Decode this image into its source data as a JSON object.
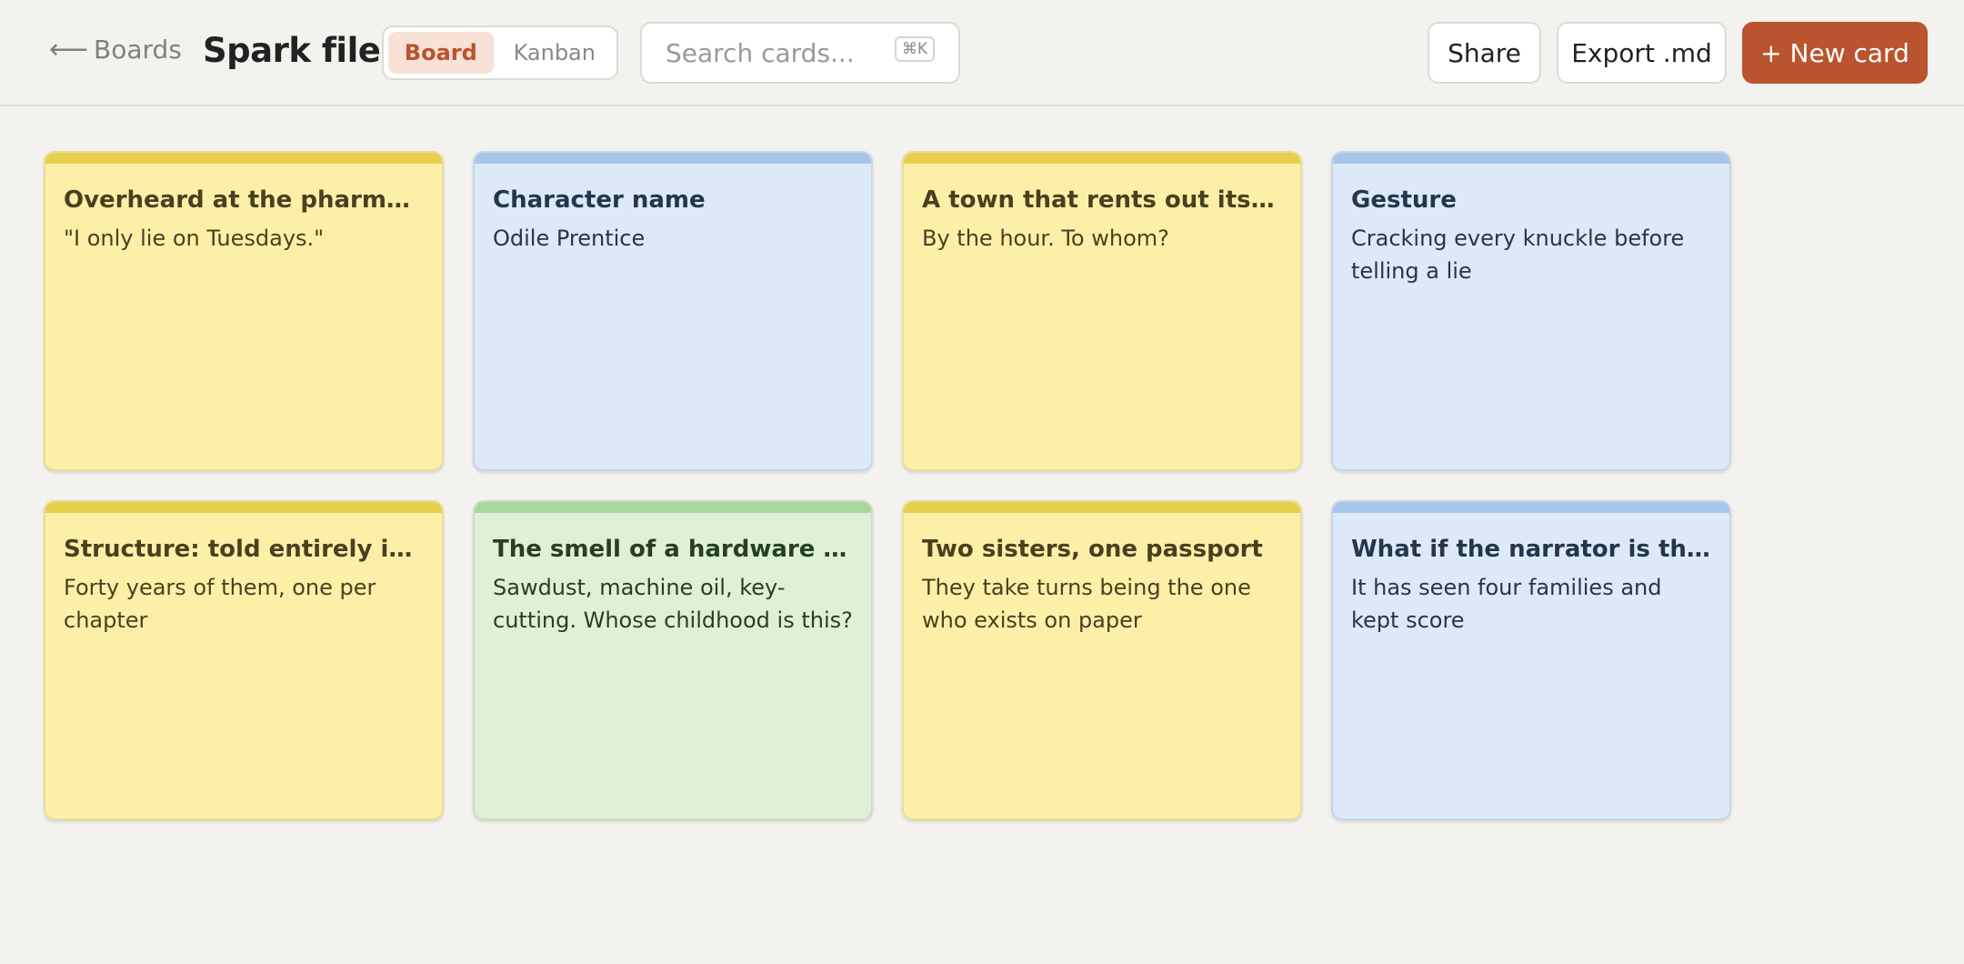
{
  "header": {
    "back_label": "Boards",
    "back_icon": "arrow-left-icon",
    "title": "Spark file",
    "views": [
      {
        "label": "Board",
        "active": true
      },
      {
        "label": "Kanban",
        "active": false
      }
    ],
    "search": {
      "placeholder": "Search cards...",
      "value": "",
      "shortcut": "⌘K"
    },
    "actions": {
      "share_label": "Share",
      "export_label": "Export .md",
      "new_card_label": "+ New card"
    }
  },
  "colors": {
    "accent": "#b9542f",
    "yellow": "#fcf0a8",
    "blue": "#dbe9f8",
    "green": "#def0d8"
  },
  "cards": [
    {
      "title": "Overheard at the pharmacy",
      "body": "\"I only lie on Tuesdays.\"",
      "color": "yellow"
    },
    {
      "title": "Character name",
      "body": "Odile Prentice",
      "color": "blue"
    },
    {
      "title": "A town that rents out its church bells",
      "body": "By the hour. To whom?",
      "color": "yellow"
    },
    {
      "title": "Gesture",
      "body": "Cracking every knuckle before telling a lie",
      "color": "blue"
    },
    {
      "title": "Structure: told entirely in voicemails",
      "body": "Forty years of them, one per chapter",
      "color": "yellow"
    },
    {
      "title": "The smell of a hardware store",
      "body": "Sawdust, machine oil, key-cutting. Whose childhood is this?",
      "color": "green"
    },
    {
      "title": "Two sisters, one passport",
      "body": "They take turns being the one who exists on paper",
      "color": "yellow"
    },
    {
      "title": "What if the narrator is the house?",
      "body": "It has seen four families and kept score",
      "color": "blue"
    }
  ]
}
